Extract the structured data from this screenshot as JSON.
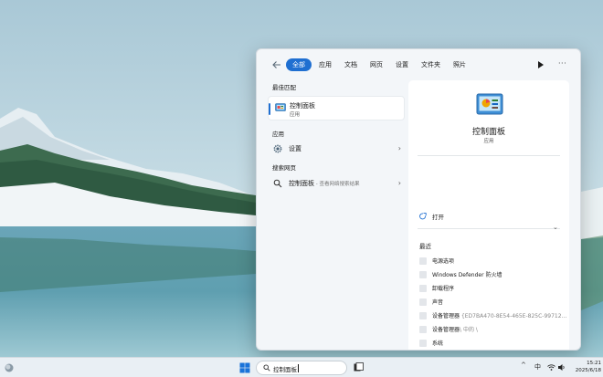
{
  "colors": {
    "accent": "#1f6fd1",
    "flyout_bg": "#f3f6f9",
    "taskbar_bg": "#e9eff4"
  },
  "filters": {
    "tabs": [
      "全部",
      "应用",
      "文档",
      "网页",
      "设置",
      "文件夹",
      "照片"
    ],
    "active": "全部"
  },
  "left": {
    "best_match_header": "最佳匹配",
    "best_match": {
      "name": "控制面板",
      "type": "应用",
      "icon": "control-panel-icon"
    },
    "apps_header": "应用",
    "apps": [
      {
        "name": "设置",
        "icon": "settings-gear-icon"
      }
    ],
    "web_header": "搜索网页",
    "web": {
      "query": "控制面板",
      "suffix": " - 查看网络搜索结果",
      "icon": "search-icon"
    }
  },
  "detail": {
    "name": "控制面板",
    "type": "应用",
    "open_label": "打开",
    "recent_header": "最近",
    "recent": [
      {
        "label": "电源选项",
        "detail": ""
      },
      {
        "label": "Windows Defender 防火墙",
        "detail": ""
      },
      {
        "label": "卸载程序",
        "detail": ""
      },
      {
        "label": "声音",
        "detail": ""
      },
      {
        "label": "设备管理器",
        "detail": "{ED7BA470-8E54-465E-825C-99712..."
      },
      {
        "label": "设备管理器",
        "detail": "\\ 中的 \\"
      },
      {
        "label": "系统",
        "detail": ""
      }
    ]
  },
  "taskbar": {
    "search_text": "控制面板",
    "ime": "中",
    "time": "15:21",
    "date": "2025/6/18"
  }
}
